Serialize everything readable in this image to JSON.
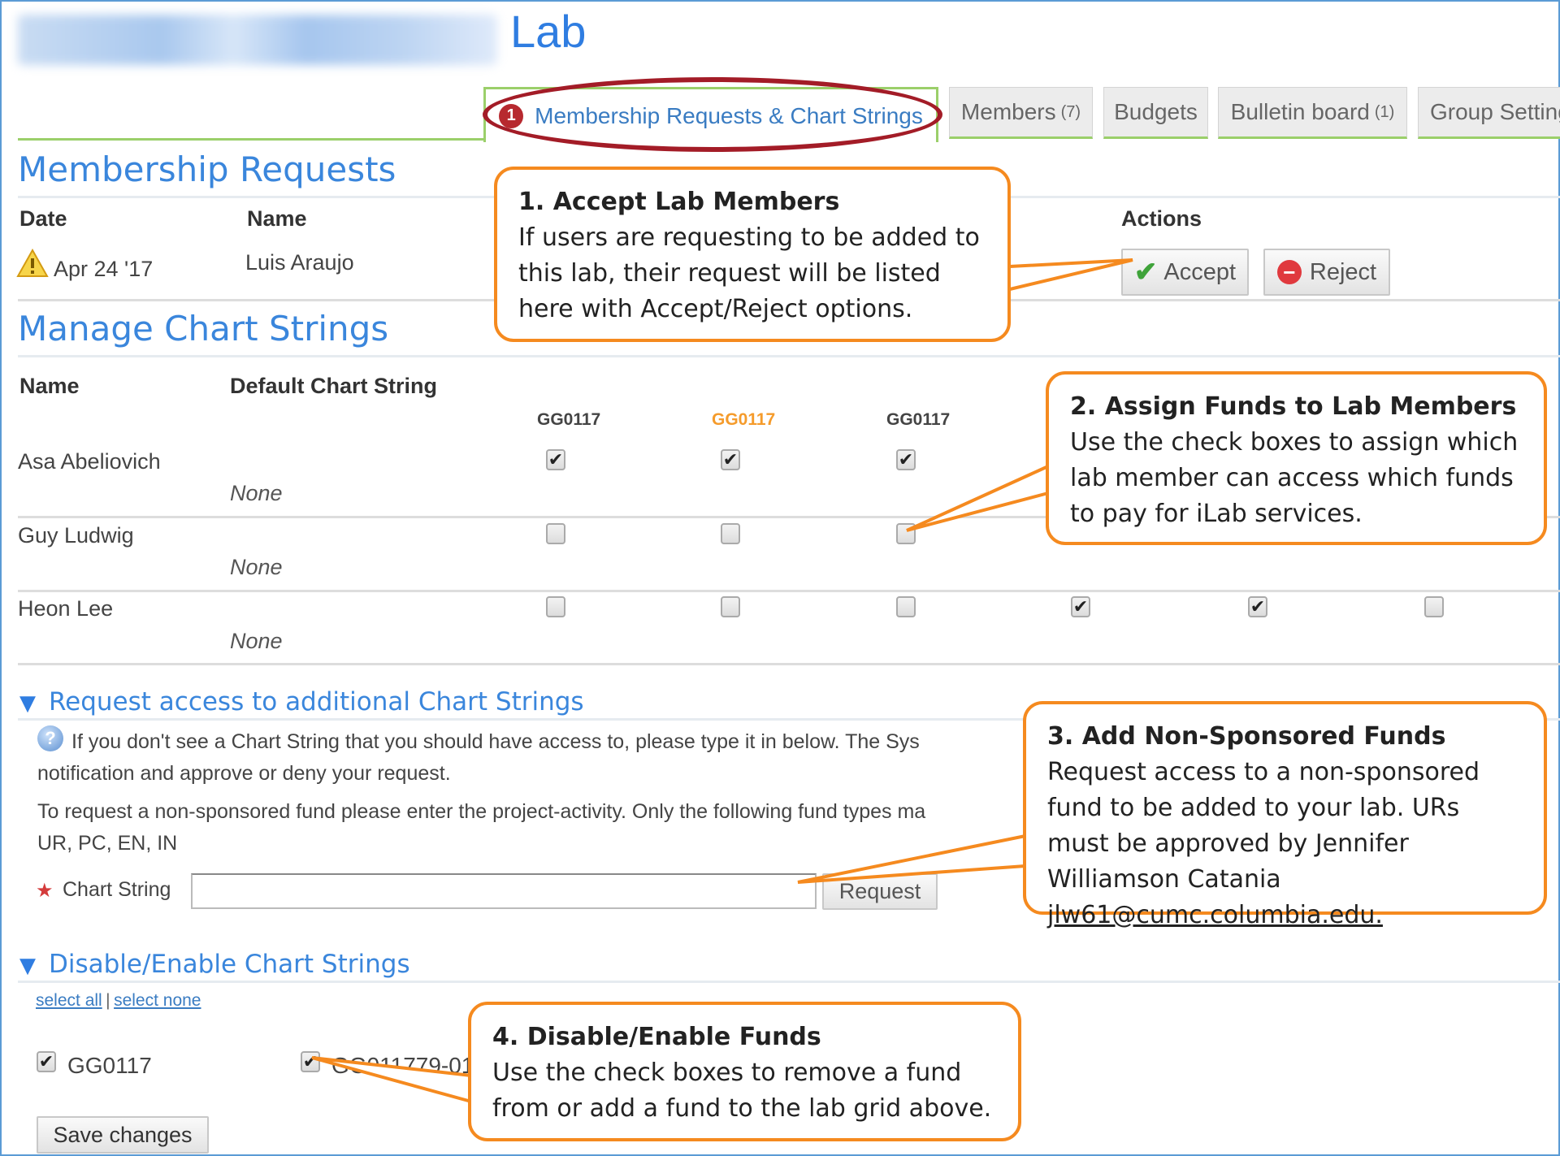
{
  "header": {
    "lab_title": "Lab",
    "blurred_name": "[blurred lab owner name]"
  },
  "tabs": [
    {
      "label": "Membership Requests & Chart Strings",
      "badge": "1",
      "active": true
    },
    {
      "label": "Members",
      "count": "(7)",
      "active": false
    },
    {
      "label": "Budgets",
      "active": false
    },
    {
      "label": "Bulletin board",
      "count": "(1)",
      "active": false
    },
    {
      "label": "Group Setting",
      "active": false
    }
  ],
  "membership_requests": {
    "heading": "Membership Requests",
    "columns": {
      "date": "Date",
      "name": "Name",
      "actions": "Actions"
    },
    "rows": [
      {
        "date": "Apr 24 '17",
        "name": "Luis Araujo",
        "icon": "warning-icon"
      }
    ],
    "accept_label": "Accept",
    "reject_label": "Reject"
  },
  "chart_strings": {
    "heading": "Manage Chart Strings",
    "columns": {
      "name": "Name",
      "default": "Default Chart String"
    },
    "funds": [
      {
        "label": "GG0117",
        "color": "#444444"
      },
      {
        "label": "GG0117",
        "color": "#f59b2b"
      },
      {
        "label": "GG0117",
        "color": "#444444"
      }
    ],
    "members": [
      {
        "name": "Asa Abeliovich",
        "default": "None",
        "checks": [
          true,
          true,
          true,
          null,
          null,
          null
        ]
      },
      {
        "name": "Guy Ludwig",
        "default": "None",
        "checks": [
          false,
          false,
          false,
          null,
          null,
          null
        ]
      },
      {
        "name": "Heon Lee",
        "default": "None",
        "checks": [
          false,
          false,
          false,
          true,
          true,
          false
        ]
      }
    ]
  },
  "request_access": {
    "heading": "Request access to additional Chart Strings",
    "info_line1": "If you don't see a Chart String that you should have access to, please type it in below. The Sys",
    "info_line2": "notification and approve or deny your request.",
    "fund_line1": "To request a non-sponsored fund please enter the project-activity. Only the following fund types ma",
    "fund_line2": "UR, PC, EN, IN",
    "field_label": "Chart String",
    "field_value": "",
    "request_label": "Request"
  },
  "disable_enable": {
    "heading": "Disable/Enable Chart Strings",
    "select_all": "select all",
    "separator": "|",
    "select_none": "select none",
    "items": [
      {
        "label": "GG0117",
        "checked": true
      },
      {
        "label": "GG011779-01",
        "checked": true
      }
    ],
    "save_label": "Save changes"
  },
  "callouts": [
    {
      "title": "1. Accept Lab Members",
      "body": "If users are requesting to be added to this lab, their request will be listed here with Accept/Reject options."
    },
    {
      "title": "2. Assign Funds to Lab Members",
      "body": "Use the check boxes to assign which lab member can access which funds to pay for iLab services."
    },
    {
      "title": "3. Add Non-Sponsored Funds",
      "body": "Request access to a non-sponsored fund to be added to your lab. URs must be approved by Jennifer Williamson Catania",
      "email": "jlw61@cumc.columbia.edu."
    },
    {
      "title": "4. Disable/Enable Funds",
      "body": "Use the check boxes to remove a fund from or add a fund to the lab grid above."
    }
  ],
  "colors": {
    "accent_blue": "#3a86dc",
    "tab_green": "#9bcf6a",
    "annotation_orange": "#f58a1f",
    "annotation_red": "#a31c27"
  }
}
